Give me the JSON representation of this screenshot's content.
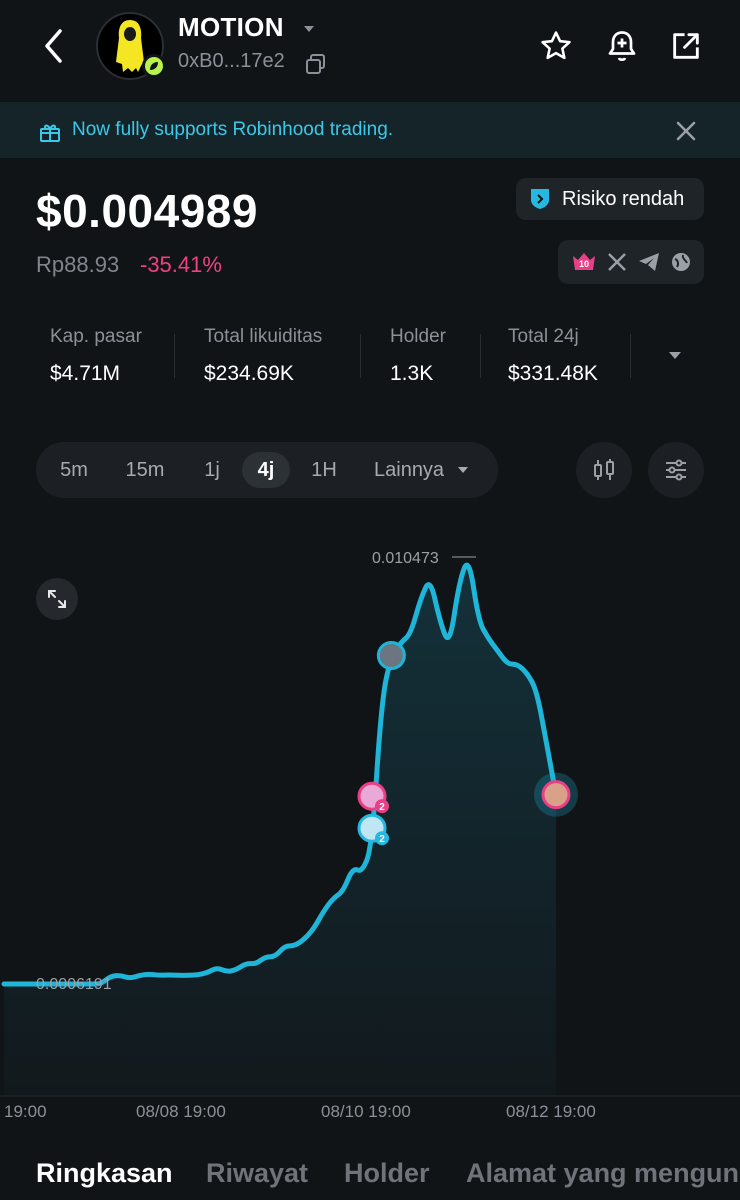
{
  "header": {
    "token_name": "MOTION",
    "address": "0xB0...17e2"
  },
  "banner": {
    "text": "Now fully supports Robinhood trading."
  },
  "price": {
    "usd": "$0.004989",
    "idr": "Rp88.93",
    "change": "-35.41%",
    "change_color": "#f0417a"
  },
  "risk": {
    "label": "Risiko rendah"
  },
  "socials": {
    "badge_count": "10",
    "items": [
      "crown-badge",
      "x-icon",
      "telegram-icon",
      "website-icon"
    ]
  },
  "stats": [
    {
      "label": "Kap. pasar",
      "value": "$4.71M"
    },
    {
      "label": "Total likuiditas",
      "value": "$234.69K"
    },
    {
      "label": "Holder",
      "value": "1.3K"
    },
    {
      "label": "Total 24j",
      "value": "$331.48K"
    }
  ],
  "timeframes": {
    "items": [
      "5m",
      "15m",
      "1j",
      "4j",
      "1H",
      "Lainnya"
    ],
    "selected": "4j"
  },
  "chart_data": {
    "type": "area",
    "line_color": "#1fb5d8",
    "max_label": "0.010473",
    "min_label": "0.0006191",
    "x_ticks": [
      "19:00",
      "08/08 19:00",
      "08/10 19:00",
      "08/12 19:00"
    ],
    "markers": [
      {
        "name": "trader-avatar-pink",
        "count": "2"
      },
      {
        "name": "trader-avatar-blue",
        "count": "2"
      },
      {
        "name": "trader-avatar-top",
        "count": ""
      },
      {
        "name": "trader-avatar-current",
        "count": ""
      }
    ],
    "x": [
      0,
      1,
      2,
      3,
      4,
      5,
      6,
      7,
      8,
      9,
      10,
      11,
      12,
      13,
      14,
      15,
      16,
      17,
      18,
      19,
      20,
      21,
      22,
      23,
      24,
      25,
      26,
      27,
      28,
      29,
      30,
      31,
      32,
      33,
      34,
      35,
      36,
      37,
      38,
      39,
      40,
      41,
      42,
      43,
      44,
      45,
      46,
      47,
      48,
      49,
      50,
      51,
      52,
      53,
      54,
      55,
      56,
      57,
      58,
      59,
      60,
      61,
      62,
      63,
      64,
      65,
      66,
      67,
      68,
      69,
      70,
      71,
      72,
      73,
      74,
      75,
      76,
      77,
      78,
      79,
      80,
      81,
      82,
      83,
      84,
      85
    ],
    "values": [
      0.00062,
      0.00062,
      0.00062,
      0.00062,
      0.00062,
      0.00062,
      0.00062,
      0.00062,
      0.00062,
      0.00062,
      0.00062,
      0.0008,
      0.00082,
      0.00075,
      0.00082,
      0.00085,
      0.00082,
      0.00083,
      0.00082,
      0.00082,
      0.00083,
      0.00088,
      0.001,
      0.0009,
      0.00095,
      0.0011,
      0.00108,
      0.00125,
      0.00125,
      0.0015,
      0.0015,
      0.00165,
      0.0019,
      0.0023,
      0.0026,
      0.00275,
      0.0033,
      0.0032,
      0.0038,
      0.0072,
      0.0082,
      0.0085,
      0.0087,
      0.0095,
      0.01,
      0.009,
      0.0084,
      0.0099,
      0.0105,
      0.009,
      0.0086,
      0.0083,
      0.008,
      0.008,
      0.0078,
      0.0074,
      0.0062,
      0.00499
    ]
  },
  "tabs": {
    "items": [
      "Ringkasan",
      "Riwayat",
      "Holder",
      "Alamat yang mengun"
    ],
    "selected": "Ringkasan"
  }
}
